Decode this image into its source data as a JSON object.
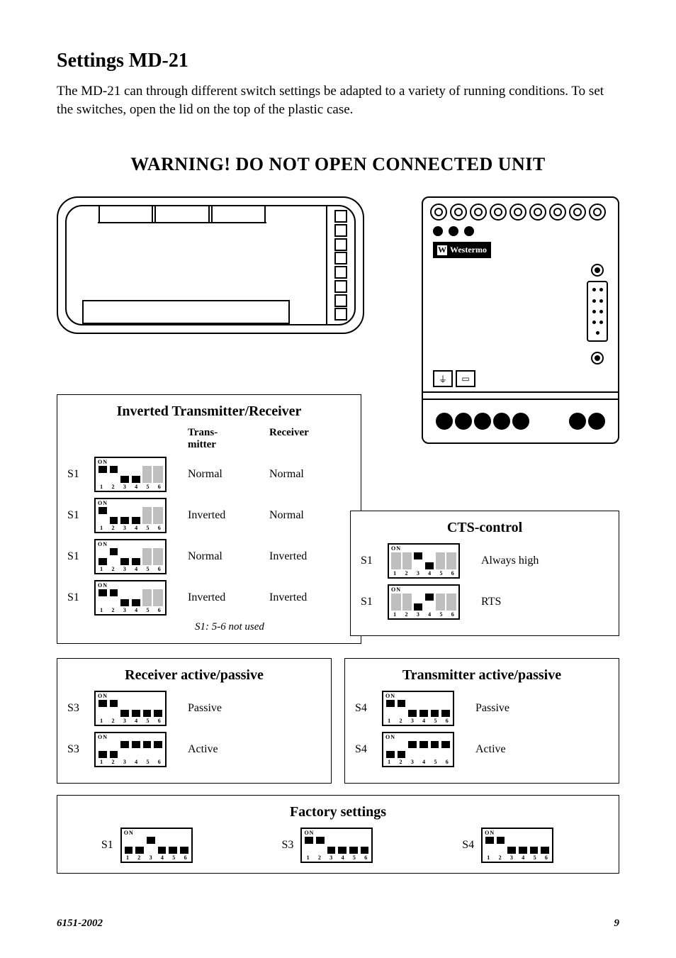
{
  "title": "Settings MD-21",
  "intro": "The MD-21 can through different switch settings be adapted to a variety of running conditions. To set the switches, open the lid on the top of the plastic case.",
  "warning": "WARNING! DO NOT OPEN CONNECTED UNIT",
  "brand": "Westermo",
  "boxes": {
    "inverted": {
      "title": "Inverted Transmitter/Receiver",
      "col1": "Trans-\nmitter",
      "col2": "Receiver",
      "note": "S1: 5-6 not used",
      "rows": [
        {
          "sw": "S1",
          "pattern": [
            1,
            1,
            0,
            0,
            0,
            0
          ],
          "gray": [
            0,
            0,
            0,
            0,
            1,
            1
          ],
          "v1": "Normal",
          "v2": "Normal"
        },
        {
          "sw": "S1",
          "pattern": [
            1,
            0,
            0,
            0,
            0,
            0
          ],
          "gray": [
            0,
            0,
            0,
            0,
            1,
            1
          ],
          "v1": "Inverted",
          "v2": "Normal"
        },
        {
          "sw": "S1",
          "pattern": [
            0,
            1,
            0,
            0,
            0,
            0
          ],
          "gray": [
            0,
            0,
            0,
            0,
            1,
            1
          ],
          "v1": "Normal",
          "v2": "Inverted"
        },
        {
          "sw": "S1",
          "pattern": [
            1,
            1,
            0,
            0,
            0,
            0
          ],
          "gray": [
            0,
            0,
            0,
            0,
            1,
            1
          ],
          "alt": [
            0,
            0,
            0,
            0,
            0,
            0
          ],
          "v1": "Inverted",
          "v2": "Inverted"
        }
      ]
    },
    "cts": {
      "title": "CTS-control",
      "rows": [
        {
          "sw": "S1",
          "pattern": [
            0,
            0,
            1,
            0,
            0,
            0
          ],
          "gray": [
            1,
            1,
            0,
            0,
            1,
            1
          ],
          "v": "Always high"
        },
        {
          "sw": "S1",
          "pattern": [
            0,
            0,
            0,
            1,
            0,
            0
          ],
          "gray": [
            1,
            1,
            0,
            0,
            1,
            1
          ],
          "v": "RTS"
        }
      ]
    },
    "rx": {
      "title": "Receiver active/passive",
      "rows": [
        {
          "sw": "S3",
          "pattern": [
            1,
            1,
            0,
            0,
            0,
            0
          ],
          "v": "Passive"
        },
        {
          "sw": "S3",
          "pattern": [
            0,
            0,
            1,
            1,
            1,
            1
          ],
          "alt": [
            0,
            0,
            0,
            0,
            0,
            0
          ],
          "v": "Active"
        }
      ]
    },
    "tx": {
      "title": "Transmitter active/passive",
      "rows": [
        {
          "sw": "S4",
          "pattern": [
            1,
            1,
            0,
            0,
            0,
            0
          ],
          "v": "Passive"
        },
        {
          "sw": "S4",
          "pattern": [
            0,
            0,
            1,
            1,
            1,
            1
          ],
          "alt": [
            0,
            0,
            0,
            0,
            0,
            0
          ],
          "v": "Active"
        }
      ]
    },
    "factory": {
      "title": "Factory settings",
      "items": [
        {
          "sw": "S1",
          "pattern": [
            0,
            0,
            1,
            0,
            0,
            0
          ],
          "alt": [
            1,
            1,
            0,
            1,
            1,
            1
          ]
        },
        {
          "sw": "S3",
          "pattern": [
            1,
            1,
            0,
            0,
            0,
            0
          ],
          "alt": [
            0,
            0,
            1,
            1,
            1,
            1
          ]
        },
        {
          "sw": "S4",
          "pattern": [
            1,
            1,
            0,
            0,
            0,
            0
          ],
          "alt": [
            0,
            0,
            1,
            1,
            1,
            1
          ]
        }
      ]
    }
  },
  "footer": {
    "doc": "6151-2002",
    "page": "9"
  }
}
